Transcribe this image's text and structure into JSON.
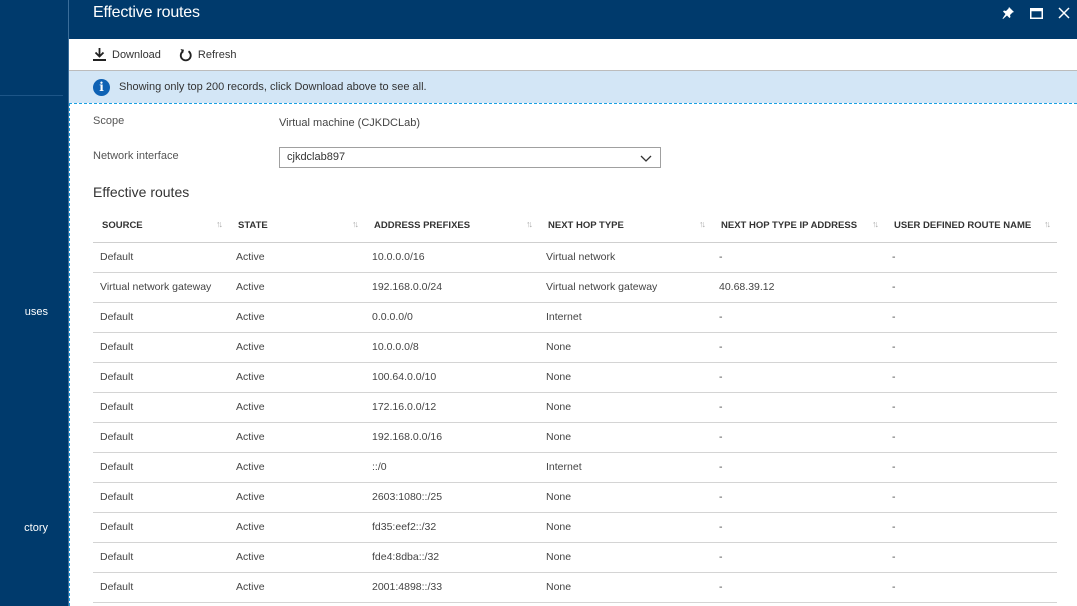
{
  "sidebar": {
    "partial_items": [
      "uses",
      "ctory"
    ]
  },
  "blade": {
    "title": "Effective routes",
    "header_icons": [
      "pin-icon",
      "maximize-icon",
      "close-icon"
    ]
  },
  "toolbar": {
    "download_label": "Download",
    "refresh_label": "Refresh"
  },
  "info": {
    "message": "Showing only top 200 records, click Download above to see all."
  },
  "form": {
    "scope_label": "Scope",
    "scope_value": "Virtual machine (CJKDCLab)",
    "nic_label": "Network interface",
    "nic_value": "cjkdclab897"
  },
  "section_title": "Effective routes",
  "table": {
    "columns": [
      "SOURCE",
      "STATE",
      "ADDRESS PREFIXES",
      "NEXT HOP TYPE",
      "NEXT HOP TYPE IP ADDRESS",
      "USER DEFINED ROUTE NAME"
    ],
    "sort_glyph": "↑↓",
    "rows": [
      [
        "Default",
        "Active",
        "10.0.0.0/16",
        "Virtual network",
        "-",
        "-"
      ],
      [
        "Virtual network gateway",
        "Active",
        "192.168.0.0/24",
        "Virtual network gateway",
        "40.68.39.12",
        "-"
      ],
      [
        "Default",
        "Active",
        "0.0.0.0/0",
        "Internet",
        "-",
        "-"
      ],
      [
        "Default",
        "Active",
        "10.0.0.0/8",
        "None",
        "-",
        "-"
      ],
      [
        "Default",
        "Active",
        "100.64.0.0/10",
        "None",
        "-",
        "-"
      ],
      [
        "Default",
        "Active",
        "172.16.0.0/12",
        "None",
        "-",
        "-"
      ],
      [
        "Default",
        "Active",
        "192.168.0.0/16",
        "None",
        "-",
        "-"
      ],
      [
        "Default",
        "Active",
        "::/0",
        "Internet",
        "-",
        "-"
      ],
      [
        "Default",
        "Active",
        "2603:1080::/25",
        "None",
        "-",
        "-"
      ],
      [
        "Default",
        "Active",
        "fd35:eef2::/32",
        "None",
        "-",
        "-"
      ],
      [
        "Default",
        "Active",
        "fde4:8dba::/32",
        "None",
        "-",
        "-"
      ],
      [
        "Default",
        "Active",
        "2001:4898::/33",
        "None",
        "-",
        "-"
      ]
    ]
  }
}
